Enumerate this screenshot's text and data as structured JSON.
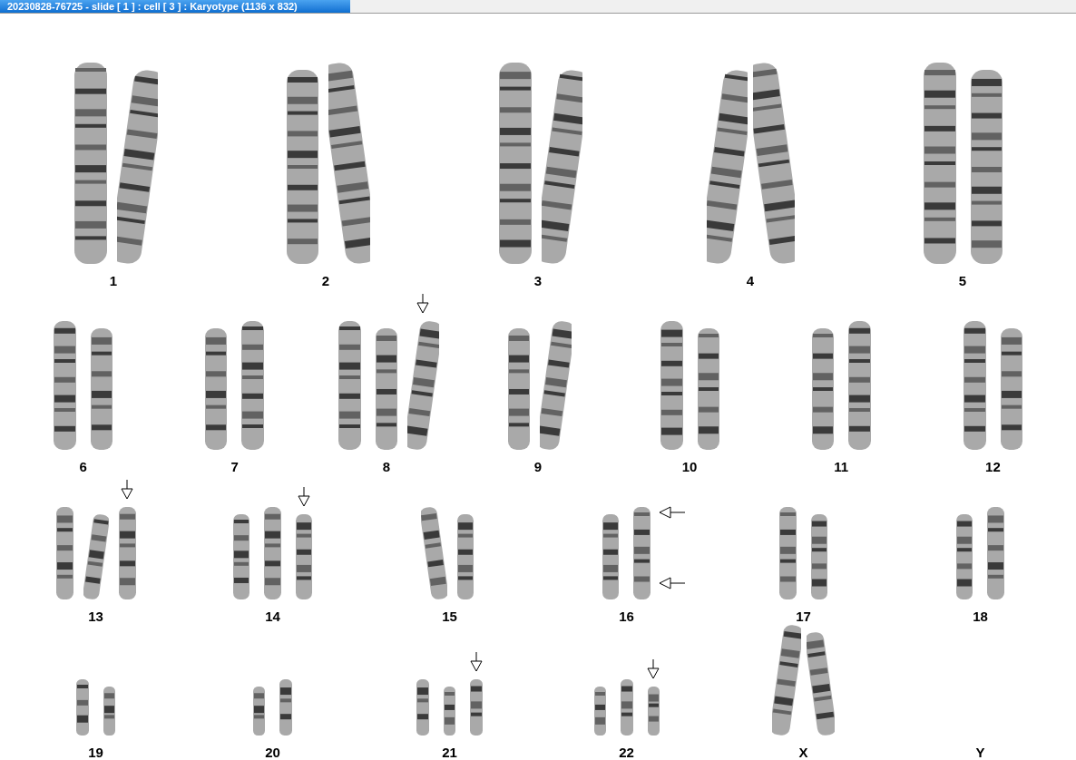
{
  "window": {
    "title": "20230828-76725 - slide [ 1 ] : cell [ 3 ] : Karyotype  (1136 x 832)"
  },
  "rows": [
    {
      "groups": [
        {
          "label": "1",
          "chromosomes": [
            {
              "bent": false
            },
            {
              "bent": true
            }
          ]
        },
        {
          "label": "2",
          "chromosomes": [
            {
              "bent": false
            },
            {
              "bent": true
            }
          ]
        },
        {
          "label": "3",
          "chromosomes": [
            {
              "bent": false
            },
            {
              "bent": true
            }
          ]
        },
        {
          "label": "4",
          "chromosomes": [
            {
              "bent": true
            },
            {
              "bent": true
            }
          ]
        },
        {
          "label": "5",
          "chromosomes": [
            {
              "bent": false
            },
            {
              "bent": false
            }
          ]
        }
      ]
    },
    {
      "groups": [
        {
          "label": "6",
          "chromosomes": [
            {
              "bent": false
            },
            {
              "bent": false
            }
          ]
        },
        {
          "label": "7",
          "chromosomes": [
            {
              "bent": false
            },
            {
              "bent": false
            }
          ]
        },
        {
          "label": "8",
          "chromosomes": [
            {
              "bent": false
            },
            {
              "bent": false
            },
            {
              "bent": true,
              "arrow_down": true
            }
          ]
        },
        {
          "label": "9",
          "chromosomes": [
            {
              "bent": false
            },
            {
              "bent": true
            }
          ]
        },
        {
          "label": "10",
          "chromosomes": [
            {
              "bent": false
            },
            {
              "bent": false
            }
          ]
        },
        {
          "label": "11",
          "chromosomes": [
            {
              "bent": false
            },
            {
              "bent": false
            }
          ]
        },
        {
          "label": "12",
          "chromosomes": [
            {
              "bent": false
            },
            {
              "bent": false
            }
          ]
        }
      ]
    },
    {
      "groups": [
        {
          "label": "13",
          "chromosomes": [
            {
              "bent": false
            },
            {
              "bent": true
            },
            {
              "bent": false,
              "arrow_down": true
            }
          ]
        },
        {
          "label": "14",
          "chromosomes": [
            {
              "bent": false
            },
            {
              "bent": false
            },
            {
              "bent": false,
              "arrow_down": true
            }
          ]
        },
        {
          "label": "15",
          "chromosomes": [
            {
              "bent": true
            },
            {
              "bent": false
            }
          ]
        },
        {
          "label": "16",
          "chromosomes": [
            {
              "bent": false
            },
            {
              "bent": false,
              "arrows_left": true
            }
          ]
        },
        {
          "label": "17",
          "chromosomes": [
            {
              "bent": false
            },
            {
              "bent": false
            }
          ]
        },
        {
          "label": "18",
          "chromosomes": [
            {
              "bent": false
            },
            {
              "bent": false
            }
          ]
        }
      ]
    },
    {
      "groups": [
        {
          "label": "19",
          "chromosomes": [
            {
              "bent": false
            },
            {
              "bent": false
            }
          ]
        },
        {
          "label": "20",
          "chromosomes": [
            {
              "bent": false
            },
            {
              "bent": false
            }
          ]
        },
        {
          "label": "21",
          "chromosomes": [
            {
              "bent": false
            },
            {
              "bent": false
            },
            {
              "bent": false,
              "arrow_down": true
            }
          ]
        },
        {
          "label": "22",
          "chromosomes": [
            {
              "bent": false
            },
            {
              "bent": false
            },
            {
              "bent": false,
              "arrow_down": true
            }
          ]
        },
        {
          "label": "X",
          "chromosomes": [
            {
              "bent": true
            },
            {
              "bent": true
            }
          ]
        },
        {
          "label": "Y"
        }
      ]
    }
  ]
}
